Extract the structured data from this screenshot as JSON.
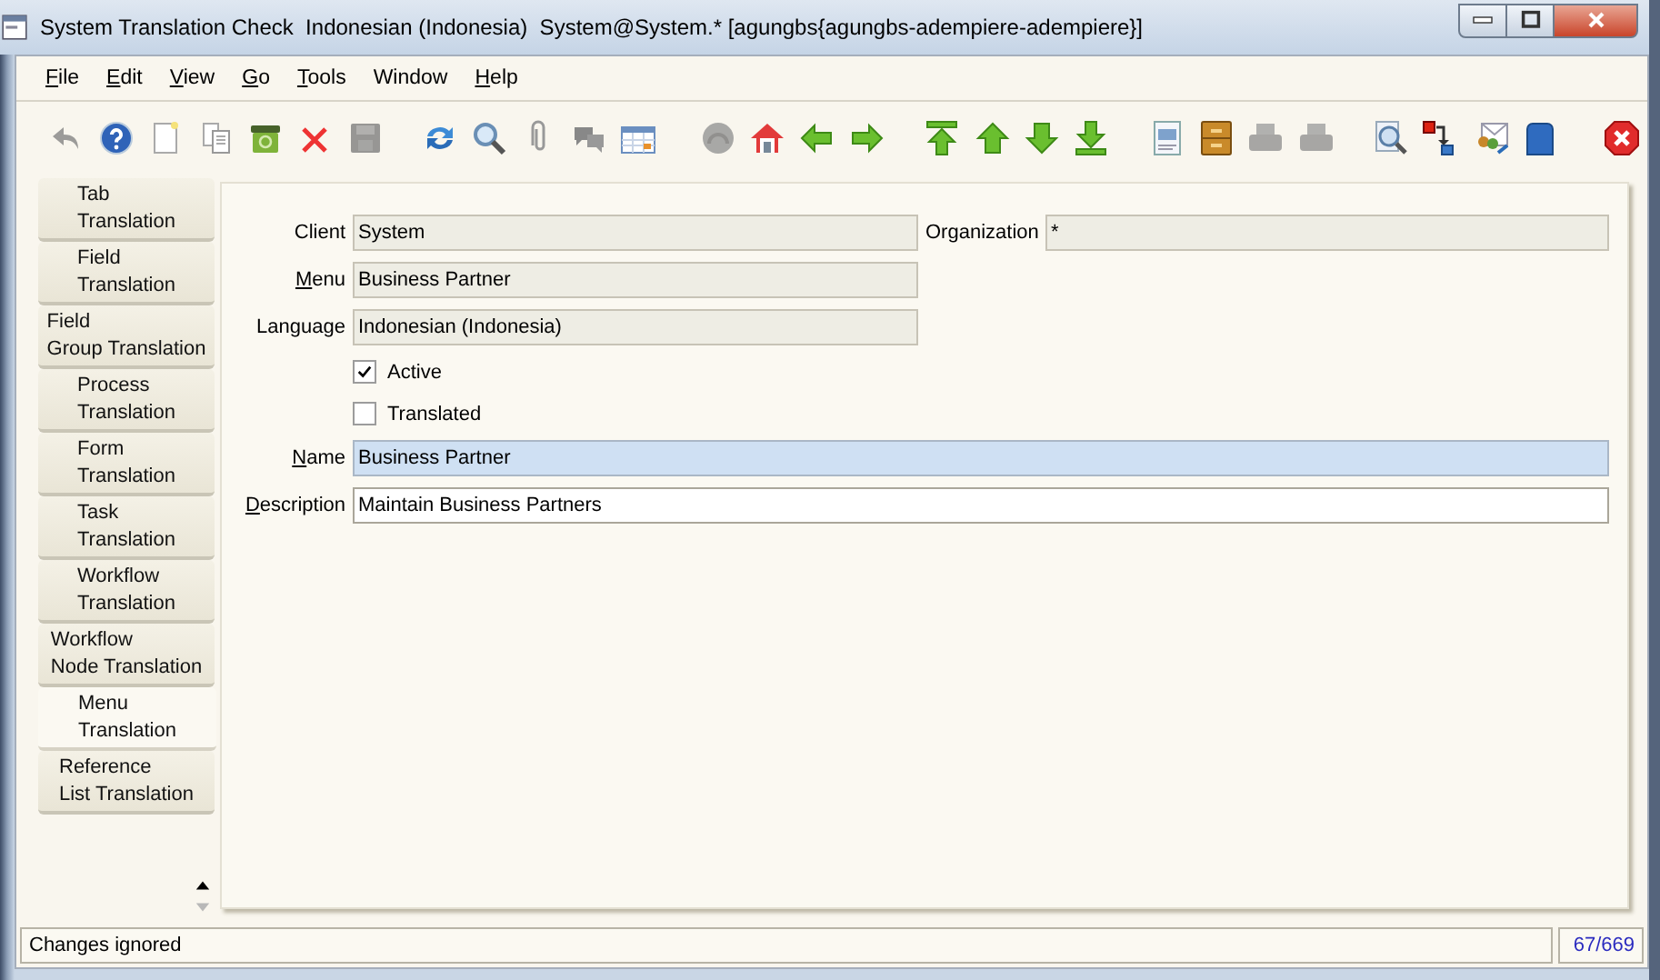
{
  "window": {
    "title": "System Translation Check  Indonesian (Indonesia)  System@System.* [agungbs{agungbs-adempiere-adempiere}]"
  },
  "menu_bar": [
    {
      "label": "File",
      "mnemonic": true
    },
    {
      "label": "Edit",
      "mnemonic": true
    },
    {
      "label": "View",
      "mnemonic": true
    },
    {
      "label": "Go",
      "mnemonic": true
    },
    {
      "label": "Tools",
      "mnemonic": true
    },
    {
      "label": "Window",
      "mnemonic": false
    },
    {
      "label": "Help",
      "mnemonic": true
    }
  ],
  "toolbar": [
    {
      "disabled": true
    },
    {
      "disabled": false
    },
    {
      "disabled": false
    },
    {
      "disabled": false
    },
    {
      "disabled": false
    },
    {
      "disabled": false
    },
    {
      "disabled": true
    },
    {
      "disabled": false
    },
    {
      "disabled": false
    },
    {
      "disabled": false
    },
    {
      "disabled": false
    },
    {
      "disabled": false
    },
    {
      "disabled": true
    },
    {
      "disabled": false
    },
    {
      "disabled": false
    },
    {
      "disabled": false
    },
    {
      "disabled": false
    },
    {
      "disabled": false
    },
    {
      "disabled": false
    },
    {
      "disabled": false
    },
    {
      "disabled": false
    },
    {
      "disabled": false
    },
    {
      "disabled": true
    },
    {
      "disabled": true
    },
    {
      "disabled": false
    },
    {
      "disabled": false
    },
    {
      "disabled": false
    },
    {
      "disabled": false
    },
    {
      "disabled": false
    }
  ],
  "tabs": [
    {
      "label": "Tab\nTranslation",
      "selected": false
    },
    {
      "label": "Field\nTranslation",
      "selected": false
    },
    {
      "label": "Field\nGroup Translation",
      "selected": false
    },
    {
      "label": "Process\nTranslation",
      "selected": false
    },
    {
      "label": "Form\nTranslation",
      "selected": false
    },
    {
      "label": "Task\nTranslation",
      "selected": false
    },
    {
      "label": "Workflow\nTranslation",
      "selected": false
    },
    {
      "label": "Workflow\nNode Translation",
      "selected": false
    },
    {
      "label": "Menu\nTranslation",
      "selected": true
    },
    {
      "label": "Reference\nList Translation",
      "selected": false
    }
  ],
  "form": {
    "rows": [
      [
        {
          "kind": "text",
          "label": "Client",
          "mnemonic": false,
          "value": "System",
          "readonly": true,
          "mandatory": false
        },
        {
          "kind": "text",
          "label": "Organization",
          "mnemonic": false,
          "value": "*",
          "readonly": true,
          "mandatory": false
        }
      ],
      [
        {
          "kind": "text",
          "label": "Menu",
          "mnemonic": true,
          "value": "Business Partner",
          "readonly": true,
          "mandatory": false
        }
      ],
      [
        {
          "kind": "text",
          "label": "Language",
          "mnemonic": false,
          "value": "Indonesian (Indonesia)",
          "readonly": true,
          "mandatory": false
        }
      ],
      [
        {
          "kind": "checkbox",
          "label": "Active",
          "checked": true
        }
      ],
      [
        {
          "kind": "checkbox",
          "label": "Translated",
          "checked": false
        }
      ],
      [
        {
          "kind": "text",
          "label": "Name",
          "mnemonic": true,
          "value": "Business Partner",
          "readonly": false,
          "mandatory": true
        }
      ],
      [
        {
          "kind": "text",
          "label": "Description",
          "mnemonic": true,
          "value": "Maintain Business Partners",
          "readonly": false,
          "mandatory": false
        }
      ]
    ]
  },
  "status_bar": {
    "message": "Changes ignored",
    "record": "67/669"
  }
}
